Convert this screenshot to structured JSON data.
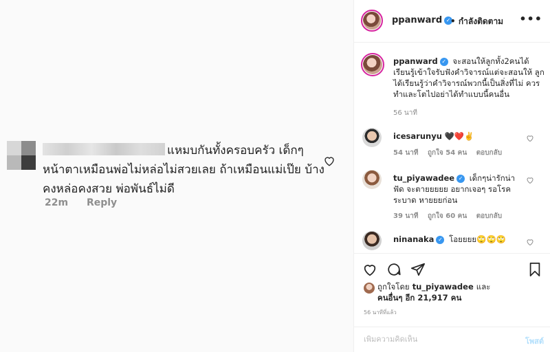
{
  "left_comment": {
    "text": "แหมบกันทั้งครอบครัว เด็กๆ หน้าตาเหมือนพ่อไม่หล่อไม่สวยเลย ถ้าเหมือนแม่เป๊ย บ้างคงหล่อคงสวย พ่อพันธ์ไม่ดี",
    "time": "22m",
    "reply": "Reply"
  },
  "header": {
    "username": "ppanward",
    "follow_label": "• กำลังติดตาม",
    "more": "•••"
  },
  "caption": {
    "username": "ppanward",
    "text": "จะสอนให้ลูกทั้ง2คนได้ เรียนรู้เข้าใจรับฟังคำวิจารณ์แต่จะสอนให้ ลูกได้เรียนรู้ว่าคำวิจารณ์พวกนี้เป็นสิ่งที่ไม่ ควรทำและโตไปอย่าได้ทำแบบนี้คนอื่น",
    "time": "56 นาที"
  },
  "comments": [
    {
      "username": "icesarunyu",
      "text": "🖤❤️✌️",
      "time": "54 นาที",
      "likes": "ถูกใจ 54 คน",
      "reply": "ตอบกลับ",
      "verified": false
    },
    {
      "username": "tu_piyawadee",
      "text": "เด็กๆน่ารักน่าฟัด จะตายยยยย อยากเจอๆ รอโรคระบาด หายยยก่อน",
      "time": "39 นาที",
      "likes": "ถูกใจ 60 คน",
      "reply": "ตอบกลับ",
      "verified": true
    },
    {
      "username": "ninanaka",
      "text": "โอยยยย🙄🙄🙄",
      "verified": true
    }
  ],
  "likes": {
    "liked_by_label": "ถูกใจโดย",
    "liked_by_user": "tu_piyawadee",
    "and_label": "และ",
    "others": "คนอื่นๆ อีก 21,917 คน"
  },
  "post_time": "56 นาทีที่แล้ว",
  "add_comment": {
    "placeholder": "เพิ่มความคิดเห็น",
    "post_label": "โพสต์"
  },
  "colors": {
    "verified": "#3897f0",
    "muted": "#8e8e8e",
    "post_disabled": "#b2dffc",
    "heart_red": "#ed4956"
  }
}
